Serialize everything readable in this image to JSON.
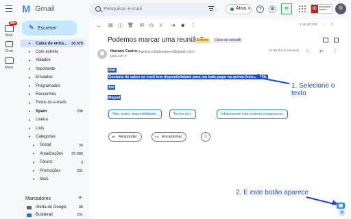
{
  "app": {
    "title": "Gmail",
    "logo_letter": "M"
  },
  "search": {
    "placeholder": "Pesquisar e-mail"
  },
  "status": {
    "label": "Ativo"
  },
  "brand": {
    "ic": "IC",
    "name": "Informática Criativa"
  },
  "rail": {
    "badge": "99+",
    "items": [
      {
        "label": "Mail",
        "icon": "mail-icon"
      },
      {
        "label": "Chat",
        "icon": "chat-icon"
      },
      {
        "label": "Meet",
        "icon": "meet-icon"
      }
    ]
  },
  "compose": {
    "label": "Escrever",
    "icon": "pencil-icon"
  },
  "nav": [
    {
      "label": "Caixa de entra...",
      "count": "30.375",
      "icon": "inbox-icon",
      "active": true
    },
    {
      "label": "Com estrela",
      "count": "",
      "icon": "star-icon"
    },
    {
      "label": "Adiados",
      "count": "",
      "icon": "clock-icon"
    },
    {
      "label": "Importante",
      "count": "",
      "icon": "label-important-icon"
    },
    {
      "label": "Enviados",
      "count": "",
      "icon": "send-icon"
    },
    {
      "label": "Programados",
      "count": "",
      "icon": "schedule-send-icon"
    },
    {
      "label": "Rascunhos",
      "count": "",
      "icon": "draft-icon"
    },
    {
      "label": "Todos os e-mails",
      "count": "",
      "icon": "all-mail-icon"
    },
    {
      "label": "Spam",
      "count": "298",
      "icon": "spam-icon",
      "bold": true
    },
    {
      "label": "Lixeira",
      "count": "",
      "icon": "trash-icon"
    },
    {
      "label": "Lists",
      "count": "",
      "icon": "list-icon"
    },
    {
      "label": "Categorias",
      "count": "",
      "icon": "category-icon"
    },
    {
      "label": "Social",
      "count": "39",
      "icon": "people-icon",
      "indent": true
    },
    {
      "label": "Atualizações",
      "count": "30.688",
      "icon": "info-icon",
      "indent": true
    },
    {
      "label": "Fóruns",
      "count": "3",
      "icon": "forum-icon",
      "indent": true
    },
    {
      "label": "Promoções",
      "count": "231",
      "icon": "tag-icon",
      "indent": true
    },
    {
      "label": "Mais",
      "count": "",
      "icon": "chevron-down-icon",
      "indent": true
    }
  ],
  "labels_section": {
    "title": "Marcadores",
    "items": [
      {
        "label": "Alerta do Google",
        "count": "38",
        "color": "#5f6368"
      },
      {
        "label": "Builderall",
        "count": "231",
        "color": "#1a73e8"
      }
    ]
  },
  "toolbar": {
    "pagination": "1 de 30.376"
  },
  "email": {
    "subject": "Podemos marcar uma reunião?",
    "chips": [
      "Externo",
      "Caixa de entrada"
    ],
    "sender_name": "Hariane Castro",
    "sender_email": "<hariane.cidadeexpress@gmail.com>",
    "to_line": "para mim",
    "timestamp": "14:05 (há 5 minutos)",
    "body_lines": [
      "Olá!",
      "Gostaria de saber se você tem disponibilidade para um bate-papo na quinta-feira às 16h.",
      "Até",
      "Miguel"
    ]
  },
  "smart_replies": [
    "Sim, tenho disponibilidade.",
    "Tenho sim.",
    "Infelizmente não poderei comparecer."
  ],
  "actions": {
    "reply": "Responder",
    "forward": "Encaminhar"
  },
  "annotations": {
    "callout_1": "1. Selecione o texto",
    "callout_2": "2. E este botão aparece",
    "color": "#1a49c8"
  },
  "colors": {
    "selection": "#1a56c8",
    "compose_bg": "#c2e7ff",
    "active_nav": "#d3e3fd"
  }
}
